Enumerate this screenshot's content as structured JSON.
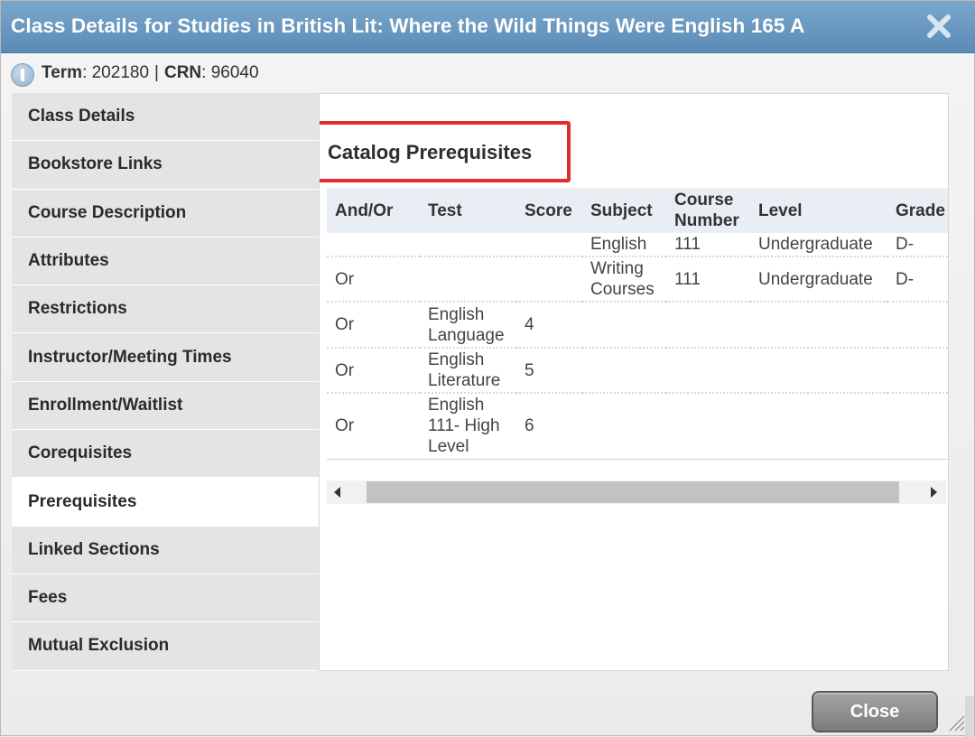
{
  "dialog": {
    "title": "Class Details for Studies in British Lit: Where the Wild Things Were English 165 A",
    "close_button": "Close"
  },
  "term_info": {
    "term_label": "Term",
    "term_value": ": 202180",
    "separator": "|",
    "crn_label": "CRN",
    "crn_value": ": 96040"
  },
  "sidebar": {
    "items": [
      {
        "label": "Class Details"
      },
      {
        "label": "Bookstore Links"
      },
      {
        "label": "Course Description"
      },
      {
        "label": "Attributes"
      },
      {
        "label": "Restrictions"
      },
      {
        "label": "Instructor/Meeting Times"
      },
      {
        "label": "Enrollment/Waitlist"
      },
      {
        "label": "Corequisites"
      },
      {
        "label": "Prerequisites",
        "active": true
      },
      {
        "label": "Linked Sections"
      },
      {
        "label": "Fees"
      },
      {
        "label": "Mutual Exclusion"
      }
    ]
  },
  "main": {
    "heading": "Catalog Prerequisites",
    "columns": [
      "And/Or",
      "Test",
      "Score",
      "Subject",
      "Course Number",
      "Level",
      "Grade"
    ],
    "rows": [
      {
        "andor": "",
        "test": "",
        "score": "",
        "subject": "English",
        "course_number": "111",
        "level": "Undergraduate",
        "grade": "D-"
      },
      {
        "andor": "Or",
        "test": "",
        "score": "",
        "subject": "Writing Courses",
        "course_number": "111",
        "level": "Undergraduate",
        "grade": "D-"
      },
      {
        "andor": "Or",
        "test": "English Language",
        "score": "4",
        "subject": "",
        "course_number": "",
        "level": "",
        "grade": ""
      },
      {
        "andor": "Or",
        "test": "English Literature",
        "score": "5",
        "subject": "",
        "course_number": "",
        "level": "",
        "grade": ""
      },
      {
        "andor": "Or",
        "test": "English 111- High Level",
        "score": "6",
        "subject": "",
        "course_number": "",
        "level": "",
        "grade": ""
      }
    ]
  },
  "colors": {
    "titlebar": "#6b99c2",
    "highlight_box": "#e02d2d",
    "active_tab": "#ffffff"
  }
}
